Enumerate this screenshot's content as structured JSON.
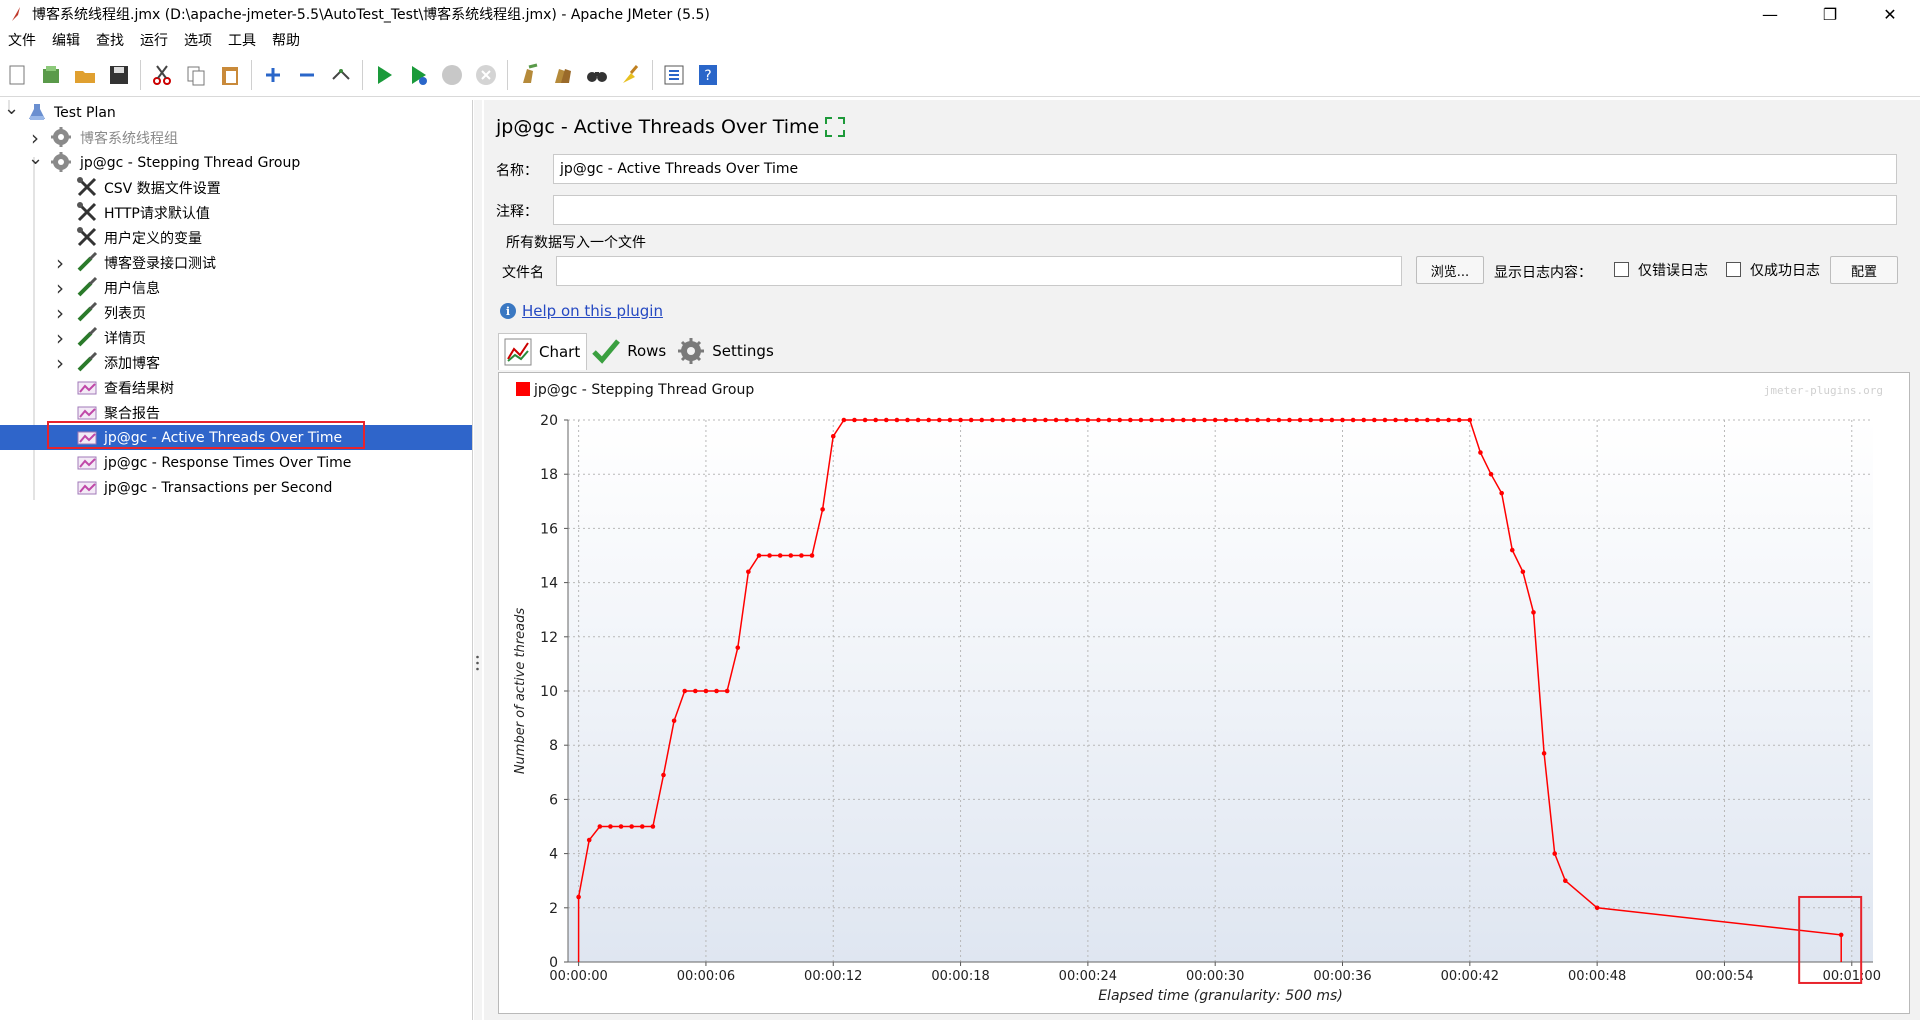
{
  "window": {
    "title": "博客系统线程组.jmx (D:\\apache-jmeter-5.5\\AutoTest_Test\\博客系统线程组.jmx) - Apache JMeter (5.5)",
    "minimize": "—",
    "restore": "❐",
    "close": "✕"
  },
  "menu": [
    "文件",
    "编辑",
    "查找",
    "运行",
    "选项",
    "工具",
    "帮助"
  ],
  "toolbar_icons": [
    "new-icon",
    "templates-icon",
    "open-icon",
    "save-icon",
    "cut-icon",
    "copy-icon",
    "paste-icon",
    "expand-all-icon",
    "collapse-all-icon",
    "toggle-icon",
    "start-icon",
    "start-no-pauses-icon",
    "stop-icon",
    "shutdown-icon",
    "clear-icon",
    "clear-all-icon",
    "search-icon",
    "reset-search-icon",
    "function-helper-icon",
    "help-icon"
  ],
  "tree": {
    "items": [
      {
        "label": "Test Plan",
        "icon": "test-plan-icon"
      },
      {
        "label": "博客系统线程组",
        "icon": "thread-group-icon"
      },
      {
        "label": "jp@gc - Stepping Thread Group",
        "icon": "thread-group-icon"
      },
      {
        "label": "CSV 数据文件设置",
        "icon": "config-element-icon"
      },
      {
        "label": "HTTP请求默认值",
        "icon": "config-element-icon"
      },
      {
        "label": "用户定义的变量",
        "icon": "config-element-icon"
      },
      {
        "label": "博客登录接口测试",
        "icon": "sampler-icon"
      },
      {
        "label": "用户信息",
        "icon": "sampler-icon"
      },
      {
        "label": "列表页",
        "icon": "sampler-icon"
      },
      {
        "label": "详情页",
        "icon": "sampler-icon"
      },
      {
        "label": "添加博客",
        "icon": "sampler-icon"
      },
      {
        "label": "查看结果树",
        "icon": "listener-icon"
      },
      {
        "label": "聚合报告",
        "icon": "listener-icon"
      },
      {
        "label": "jp@gc - Active Threads Over Time",
        "icon": "listener-icon"
      },
      {
        "label": "jp@gc - Response Times Over Time",
        "icon": "listener-icon"
      },
      {
        "label": "jp@gc - Transactions per Second",
        "icon": "listener-icon"
      }
    ]
  },
  "panel": {
    "title": "jp@gc - Active Threads Over Time",
    "name_label": "名称：",
    "name_value": "jp@gc - Active Threads Over Time",
    "comment_label": "注释：",
    "comment_value": "",
    "file_section_label": "所有数据写入一个文件",
    "filename_label": "文件名",
    "filename_value": "",
    "browse_button": "浏览...",
    "log_content_label": "显示日志内容：",
    "errors_only_label": "仅错误日志",
    "success_only_label": "仅成功日志",
    "configure_button": "配置",
    "help_link": "Help on this plugin",
    "tabs": [
      {
        "label": "Chart",
        "icon": "chart-icon"
      },
      {
        "label": "Rows",
        "icon": "rows-check-icon"
      },
      {
        "label": "Settings",
        "icon": "settings-gear-icon"
      }
    ]
  },
  "colors": {
    "series": "#ff0000",
    "selection": "#2f65ca",
    "highlight_box": "#e8232b",
    "link": "#2549c2"
  },
  "chart_data": {
    "type": "line",
    "watermark": "jmeter-plugins.org",
    "legend": "top-left",
    "grid": true,
    "xlabel": "Elapsed time (granularity: 500 ms)",
    "ylabel": "Number of active threads",
    "xlim": [
      0,
      61.5
    ],
    "ylim": [
      0,
      20
    ],
    "x_ticks": [
      "00:00:00",
      "00:00:06",
      "00:00:12",
      "00:00:18",
      "00:00:24",
      "00:00:30",
      "00:00:36",
      "00:00:42",
      "00:00:48",
      "00:00:54",
      "00:01:00"
    ],
    "y_ticks": [
      0,
      2,
      4,
      6,
      8,
      10,
      12,
      14,
      16,
      18,
      20
    ],
    "series": [
      {
        "name": "jp@gc - Stepping Thread Group",
        "points": [
          [
            0.5,
            0
          ],
          [
            0.5,
            2.4
          ],
          [
            1.0,
            4.5
          ],
          [
            1.5,
            5
          ],
          [
            2.0,
            5
          ],
          [
            2.5,
            5
          ],
          [
            3.0,
            5
          ],
          [
            3.5,
            5
          ],
          [
            4.0,
            5
          ],
          [
            4.5,
            6.9
          ],
          [
            5.0,
            8.9
          ],
          [
            5.5,
            10
          ],
          [
            6.0,
            10
          ],
          [
            6.5,
            10
          ],
          [
            7.0,
            10
          ],
          [
            7.5,
            10
          ],
          [
            8.0,
            11.6
          ],
          [
            8.5,
            14.4
          ],
          [
            9.0,
            15
          ],
          [
            9.5,
            15
          ],
          [
            10.0,
            15
          ],
          [
            10.5,
            15
          ],
          [
            11.0,
            15
          ],
          [
            11.5,
            15
          ],
          [
            12.0,
            16.7
          ],
          [
            12.5,
            19.4
          ],
          [
            13.0,
            20
          ],
          [
            13.5,
            20
          ],
          [
            14.0,
            20
          ],
          [
            14.5,
            20
          ],
          [
            15.0,
            20
          ],
          [
            15.5,
            20
          ],
          [
            16.0,
            20
          ],
          [
            16.5,
            20
          ],
          [
            17.0,
            20
          ],
          [
            17.5,
            20
          ],
          [
            18.0,
            20
          ],
          [
            18.5,
            20
          ],
          [
            19.0,
            20
          ],
          [
            19.5,
            20
          ],
          [
            20.0,
            20
          ],
          [
            20.5,
            20
          ],
          [
            21.0,
            20
          ],
          [
            21.5,
            20
          ],
          [
            22.0,
            20
          ],
          [
            22.5,
            20
          ],
          [
            23.0,
            20
          ],
          [
            23.5,
            20
          ],
          [
            24.0,
            20
          ],
          [
            24.5,
            20
          ],
          [
            25.0,
            20
          ],
          [
            25.5,
            20
          ],
          [
            26.0,
            20
          ],
          [
            26.5,
            20
          ],
          [
            27.0,
            20
          ],
          [
            27.5,
            20
          ],
          [
            28.0,
            20
          ],
          [
            28.5,
            20
          ],
          [
            29.0,
            20
          ],
          [
            29.5,
            20
          ],
          [
            30.0,
            20
          ],
          [
            30.5,
            20
          ],
          [
            31.0,
            20
          ],
          [
            31.5,
            20
          ],
          [
            32.0,
            20
          ],
          [
            32.5,
            20
          ],
          [
            33.0,
            20
          ],
          [
            33.5,
            20
          ],
          [
            34.0,
            20
          ],
          [
            34.5,
            20
          ],
          [
            35.0,
            20
          ],
          [
            35.5,
            20
          ],
          [
            36.0,
            20
          ],
          [
            36.5,
            20
          ],
          [
            37.0,
            20
          ],
          [
            37.5,
            20
          ],
          [
            38.0,
            20
          ],
          [
            38.5,
            20
          ],
          [
            39.0,
            20
          ],
          [
            39.5,
            20
          ],
          [
            40.0,
            20
          ],
          [
            40.5,
            20
          ],
          [
            41.0,
            20
          ],
          [
            41.5,
            20
          ],
          [
            42.0,
            20
          ],
          [
            42.5,
            20
          ],
          [
            43.0,
            18.8
          ],
          [
            43.5,
            18.0
          ],
          [
            44.0,
            17.3
          ],
          [
            44.5,
            15.2
          ],
          [
            45.0,
            14.4
          ],
          [
            45.5,
            12.9
          ],
          [
            46.0,
            7.7
          ],
          [
            46.5,
            4.0
          ],
          [
            47.0,
            3.0
          ],
          [
            48.5,
            2.0
          ],
          [
            60.0,
            1.0
          ],
          [
            60.0,
            0
          ]
        ]
      }
    ]
  }
}
